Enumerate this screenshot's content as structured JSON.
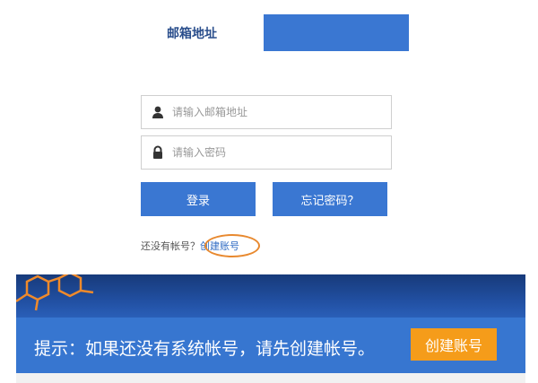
{
  "tabs": {
    "email_label": "邮箱地址"
  },
  "login": {
    "email_placeholder": "请输入邮箱地址",
    "password_placeholder": "请输入密码",
    "login_button": "登录",
    "forgot_button": "忘记密码？",
    "no_account_text": "还没有帐号？",
    "create_account_link": "创建账号"
  },
  "banner": {
    "tip_text": "提示：如果还没有系统帐号，请先创建帐号。",
    "create_button": "创建账号"
  },
  "colors": {
    "primary": "#3a77d2",
    "highlight_circle": "#e8892f",
    "banner_button": "#f59c1a"
  },
  "icons": [
    "user-icon",
    "lock-icon"
  ]
}
